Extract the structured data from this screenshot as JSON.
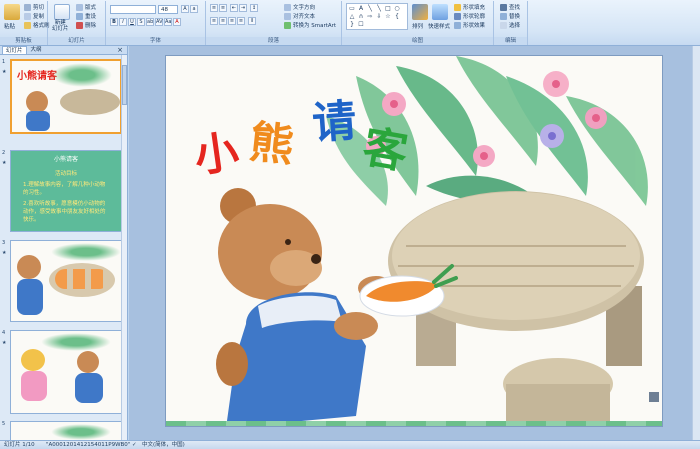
{
  "ribbon": {
    "clipboard": {
      "paste": "粘贴",
      "cut": "剪切",
      "copy": "复制",
      "format_painter": "格式刷",
      "label": "剪贴板"
    },
    "slides": {
      "new_slide": "新建",
      "new_slide_line2": "幻灯片",
      "layout": "版式",
      "reset": "重设",
      "delete": "删除",
      "label": "幻灯片"
    },
    "font": {
      "size": "48",
      "label": "字体"
    },
    "paragraph": {
      "text_direction": "文字方向",
      "align_text": "对齐文本",
      "smartart": "转换为 SmartArt",
      "label": "段落"
    },
    "drawing": {
      "arrange": "排列",
      "quick_styles": "快速样式",
      "shape_fill": "形状填充",
      "shape_outline": "形状轮廓",
      "shape_effects": "形状效果",
      "label": "绘图"
    },
    "editing": {
      "find": "查找",
      "replace": "替换",
      "select": "选择",
      "label": "编辑"
    }
  },
  "left_pane": {
    "tab_slides": "幻灯片",
    "tab_outline": "大纲",
    "close": "×",
    "thumbs": [
      {
        "num": "1",
        "title": "小熊请客"
      },
      {
        "num": "2",
        "title": "小熊请客",
        "lines": [
          "活动目标",
          "1.理解故事内容，了解几种小动物的习性。",
          "2.喜欢听故事，愿意模仿小动物的动作，感受故事中朋友友好相处的快乐。"
        ]
      },
      {
        "num": "3"
      },
      {
        "num": "4"
      },
      {
        "num": "5"
      }
    ]
  },
  "slide": {
    "title_chars": [
      "小",
      "熊",
      "请",
      "客"
    ],
    "title_colors": [
      "#e5261f",
      "#f08b1d",
      "#1f64c8",
      "#2aa63c"
    ]
  },
  "status": {
    "slide_info": "幻灯片 1/10",
    "theme": "\"A0001201412154011P9WB0\"",
    "language": "中文(简体，中国)"
  }
}
